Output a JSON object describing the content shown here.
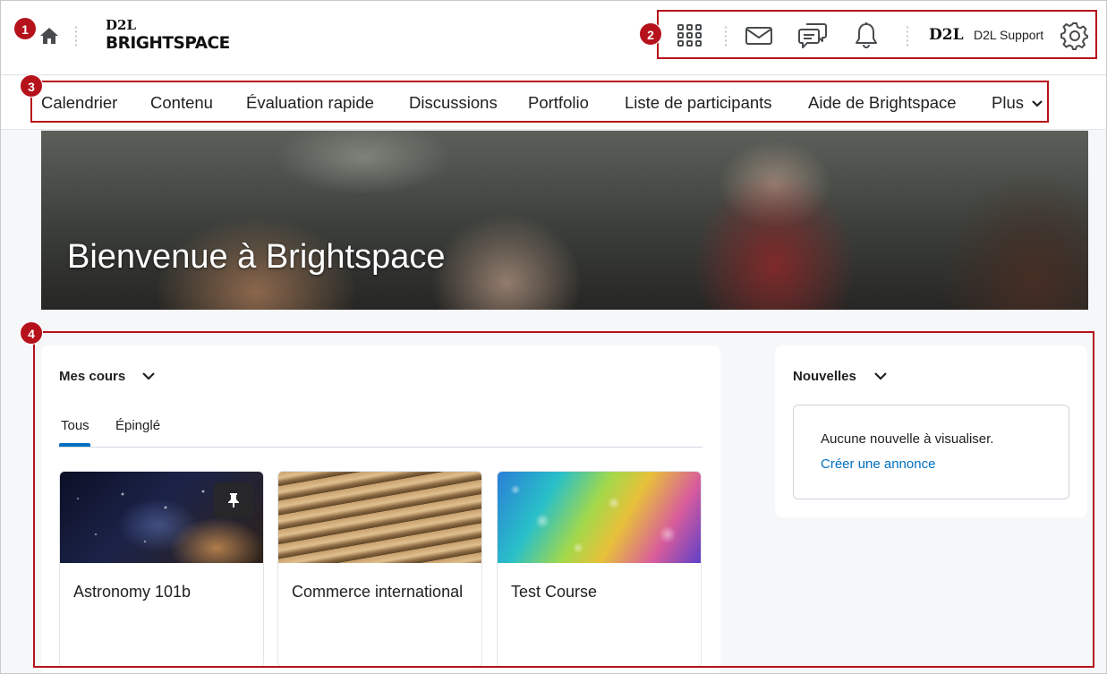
{
  "header": {
    "logo_small": "D2L",
    "logo_brand": "BRIGHTSPACE",
    "support_logo": "D2L",
    "support_label": "D2L Support",
    "icons": [
      "home-icon",
      "grid-icon",
      "mail-icon",
      "chat-icon",
      "bell-icon",
      "gear-icon"
    ]
  },
  "nav": {
    "items": [
      "Calendrier",
      "Contenu",
      "Évaluation rapide",
      "Discussions",
      "Portfolio",
      "Liste de participants",
      "Aide de Brightspace",
      "Plus"
    ]
  },
  "hero": {
    "title": "Bienvenue à Brightspace"
  },
  "my_courses": {
    "title": "Mes cours",
    "tabs": [
      "Tous",
      "Épinglé"
    ],
    "active_tab": "Tous",
    "courses": [
      {
        "name": "Astronomy 101b",
        "pinned": true
      },
      {
        "name": "Commerce international",
        "pinned": false
      },
      {
        "name": "Test Course",
        "pinned": false
      }
    ]
  },
  "news": {
    "title": "Nouvelles",
    "empty_message": "Aucune nouvelle à visualiser.",
    "create_link": "Créer une annonce"
  },
  "callouts": [
    "1",
    "2",
    "3",
    "4"
  ],
  "colors": {
    "accent": "#006fbf",
    "callout": "#b5121b"
  }
}
